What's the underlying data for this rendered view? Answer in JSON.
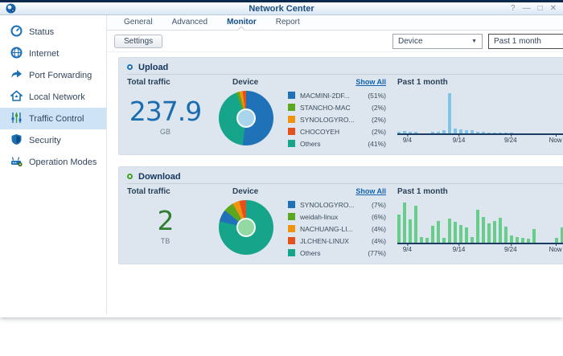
{
  "window": {
    "title": "Network Center",
    "controls": {
      "help": "?",
      "minimize": "—",
      "maximize": "□",
      "close": "✕"
    }
  },
  "sidebar": {
    "items": [
      {
        "label": "Status",
        "icon": "gauge-icon",
        "selected": false
      },
      {
        "label": "Internet",
        "icon": "globe-icon",
        "selected": false
      },
      {
        "label": "Port Forwarding",
        "icon": "forward-arrow-icon",
        "selected": false
      },
      {
        "label": "Local Network",
        "icon": "home-network-icon",
        "selected": false
      },
      {
        "label": "Traffic Control",
        "icon": "sliders-icon",
        "selected": true
      },
      {
        "label": "Security",
        "icon": "shield-icon",
        "selected": false
      },
      {
        "label": "Operation Modes",
        "icon": "router-gear-icon",
        "selected": false
      }
    ]
  },
  "tabs": {
    "items": [
      {
        "label": "General",
        "active": false
      },
      {
        "label": "Advanced",
        "active": false
      },
      {
        "label": "Monitor",
        "active": true
      },
      {
        "label": "Report",
        "active": false
      }
    ]
  },
  "toolbar": {
    "settings": "Settings",
    "device_filter": "Device",
    "period_filter": "Past 1 month"
  },
  "sections": {
    "upload": {
      "title": "Upload",
      "total_label": "Total traffic",
      "total_value": "237.9",
      "total_unit": "GB",
      "device_label": "Device",
      "show_all": "Show All",
      "period_label": "Past 1 month",
      "legend": [
        {
          "name": "MACMINI-2DF...",
          "pct": "(51%)"
        },
        {
          "name": "STANCHO-MAC",
          "pct": "(2%)"
        },
        {
          "name": "SYNOLOGYRO...",
          "pct": "(2%)"
        },
        {
          "name": "CHOCOYEH",
          "pct": "(2%)"
        },
        {
          "name": "Others",
          "pct": "(41%)"
        }
      ],
      "x_ticks": [
        "9/4",
        "9/14",
        "9/24",
        "Now"
      ]
    },
    "download": {
      "title": "Download",
      "total_label": "Total traffic",
      "total_value": "2",
      "total_unit": "TB",
      "device_label": "Device",
      "show_all": "Show All",
      "period_label": "Past 1 month",
      "legend": [
        {
          "name": "SYNOLOGYRO...",
          "pct": "(7%)"
        },
        {
          "name": "weidah-linux",
          "pct": "(6%)"
        },
        {
          "name": "NACHUANG-LI...",
          "pct": "(4%)"
        },
        {
          "name": "JLCHEN-LINUX",
          "pct": "(4%)"
        },
        {
          "name": "Others",
          "pct": "(77%)"
        }
      ],
      "x_ticks": [
        "9/4",
        "9/14",
        "9/24",
        "Now"
      ]
    }
  },
  "colors": {
    "series_blue": "#1f72b8",
    "series_green": "#5ba820",
    "series_orange": "#f0930f",
    "series_red": "#e4511c",
    "series_teal": "#16a58a",
    "upload_bar": "#7fc3e6",
    "download_bar": "#68cc8b",
    "axis": "#1d3c63",
    "big_number_blue": "#1b6db2",
    "big_number_green": "#2f7d2f",
    "panel_bg": "#dde6ee",
    "selected_item_bg": "#cee3f6",
    "titlebar_strip": "#0b2a4d"
  },
  "chart_data": [
    {
      "id": "upload-device-pie",
      "type": "pie",
      "title": "Upload by Device",
      "labels": [
        "MACMINI-2DF...",
        "STANCHO-MAC",
        "SYNOLOGYRO...",
        "CHOCOYEH",
        "Others"
      ],
      "values": [
        51,
        2,
        2,
        2,
        41
      ],
      "unit": "%",
      "colors": [
        "#1f72b8",
        "#5ba820",
        "#f0930f",
        "#e4511c",
        "#16a58a"
      ],
      "hole_color": "#a9d4ec",
      "draw": {
        "values": [
          51,
          41,
          2,
          2,
          2
        ],
        "colors": [
          "#1f72b8",
          "#16a58a",
          "#5ba820",
          "#f0930f",
          "#e4511c"
        ]
      }
    },
    {
      "id": "upload-history-bar",
      "type": "bar",
      "title": "Upload Past 1 month",
      "x_ticks": [
        "9/4",
        "9/14",
        "9/24",
        "Now"
      ],
      "tick_positions_pct": [
        6,
        37,
        68,
        95
      ],
      "values": [
        5,
        6,
        5,
        5,
        0,
        0,
        4,
        5,
        8,
        100,
        13,
        10,
        9,
        8,
        5,
        4,
        3,
        3,
        2,
        2,
        2,
        0,
        0,
        0,
        0,
        0,
        0,
        0,
        0,
        0
      ],
      "value_note": "relative height, max spike = 100",
      "color": "#7fc3e6"
    },
    {
      "id": "download-device-pie",
      "type": "pie",
      "title": "Download by Device",
      "labels": [
        "SYNOLOGYRO...",
        "weidah-linux",
        "NACHUANG-LI...",
        "JLCHEN-LINUX",
        "Others"
      ],
      "values": [
        7,
        6,
        4,
        4,
        77
      ],
      "unit": "%",
      "colors": [
        "#1f72b8",
        "#5ba820",
        "#f0930f",
        "#e4511c",
        "#16a58a"
      ],
      "hole_color": "#93d9a4",
      "draw": {
        "values": [
          77,
          7,
          6,
          4,
          4
        ],
        "colors": [
          "#16a58a",
          "#1f72b8",
          "#5ba820",
          "#f0930f",
          "#e4511c"
        ]
      }
    },
    {
      "id": "download-history-bar",
      "type": "bar",
      "title": "Download Past 1 month",
      "x_ticks": [
        "9/4",
        "9/14",
        "9/24",
        "Now"
      ],
      "tick_positions_pct": [
        6,
        37,
        68,
        95
      ],
      "values": [
        70,
        100,
        58,
        93,
        15,
        12,
        42,
        55,
        12,
        60,
        52,
        45,
        38,
        15,
        82,
        65,
        48,
        55,
        62,
        40,
        18,
        15,
        12,
        10,
        35,
        0,
        0,
        0,
        12,
        38
      ],
      "value_note": "relative height, max = 100",
      "color": "#68cc8b"
    }
  ]
}
